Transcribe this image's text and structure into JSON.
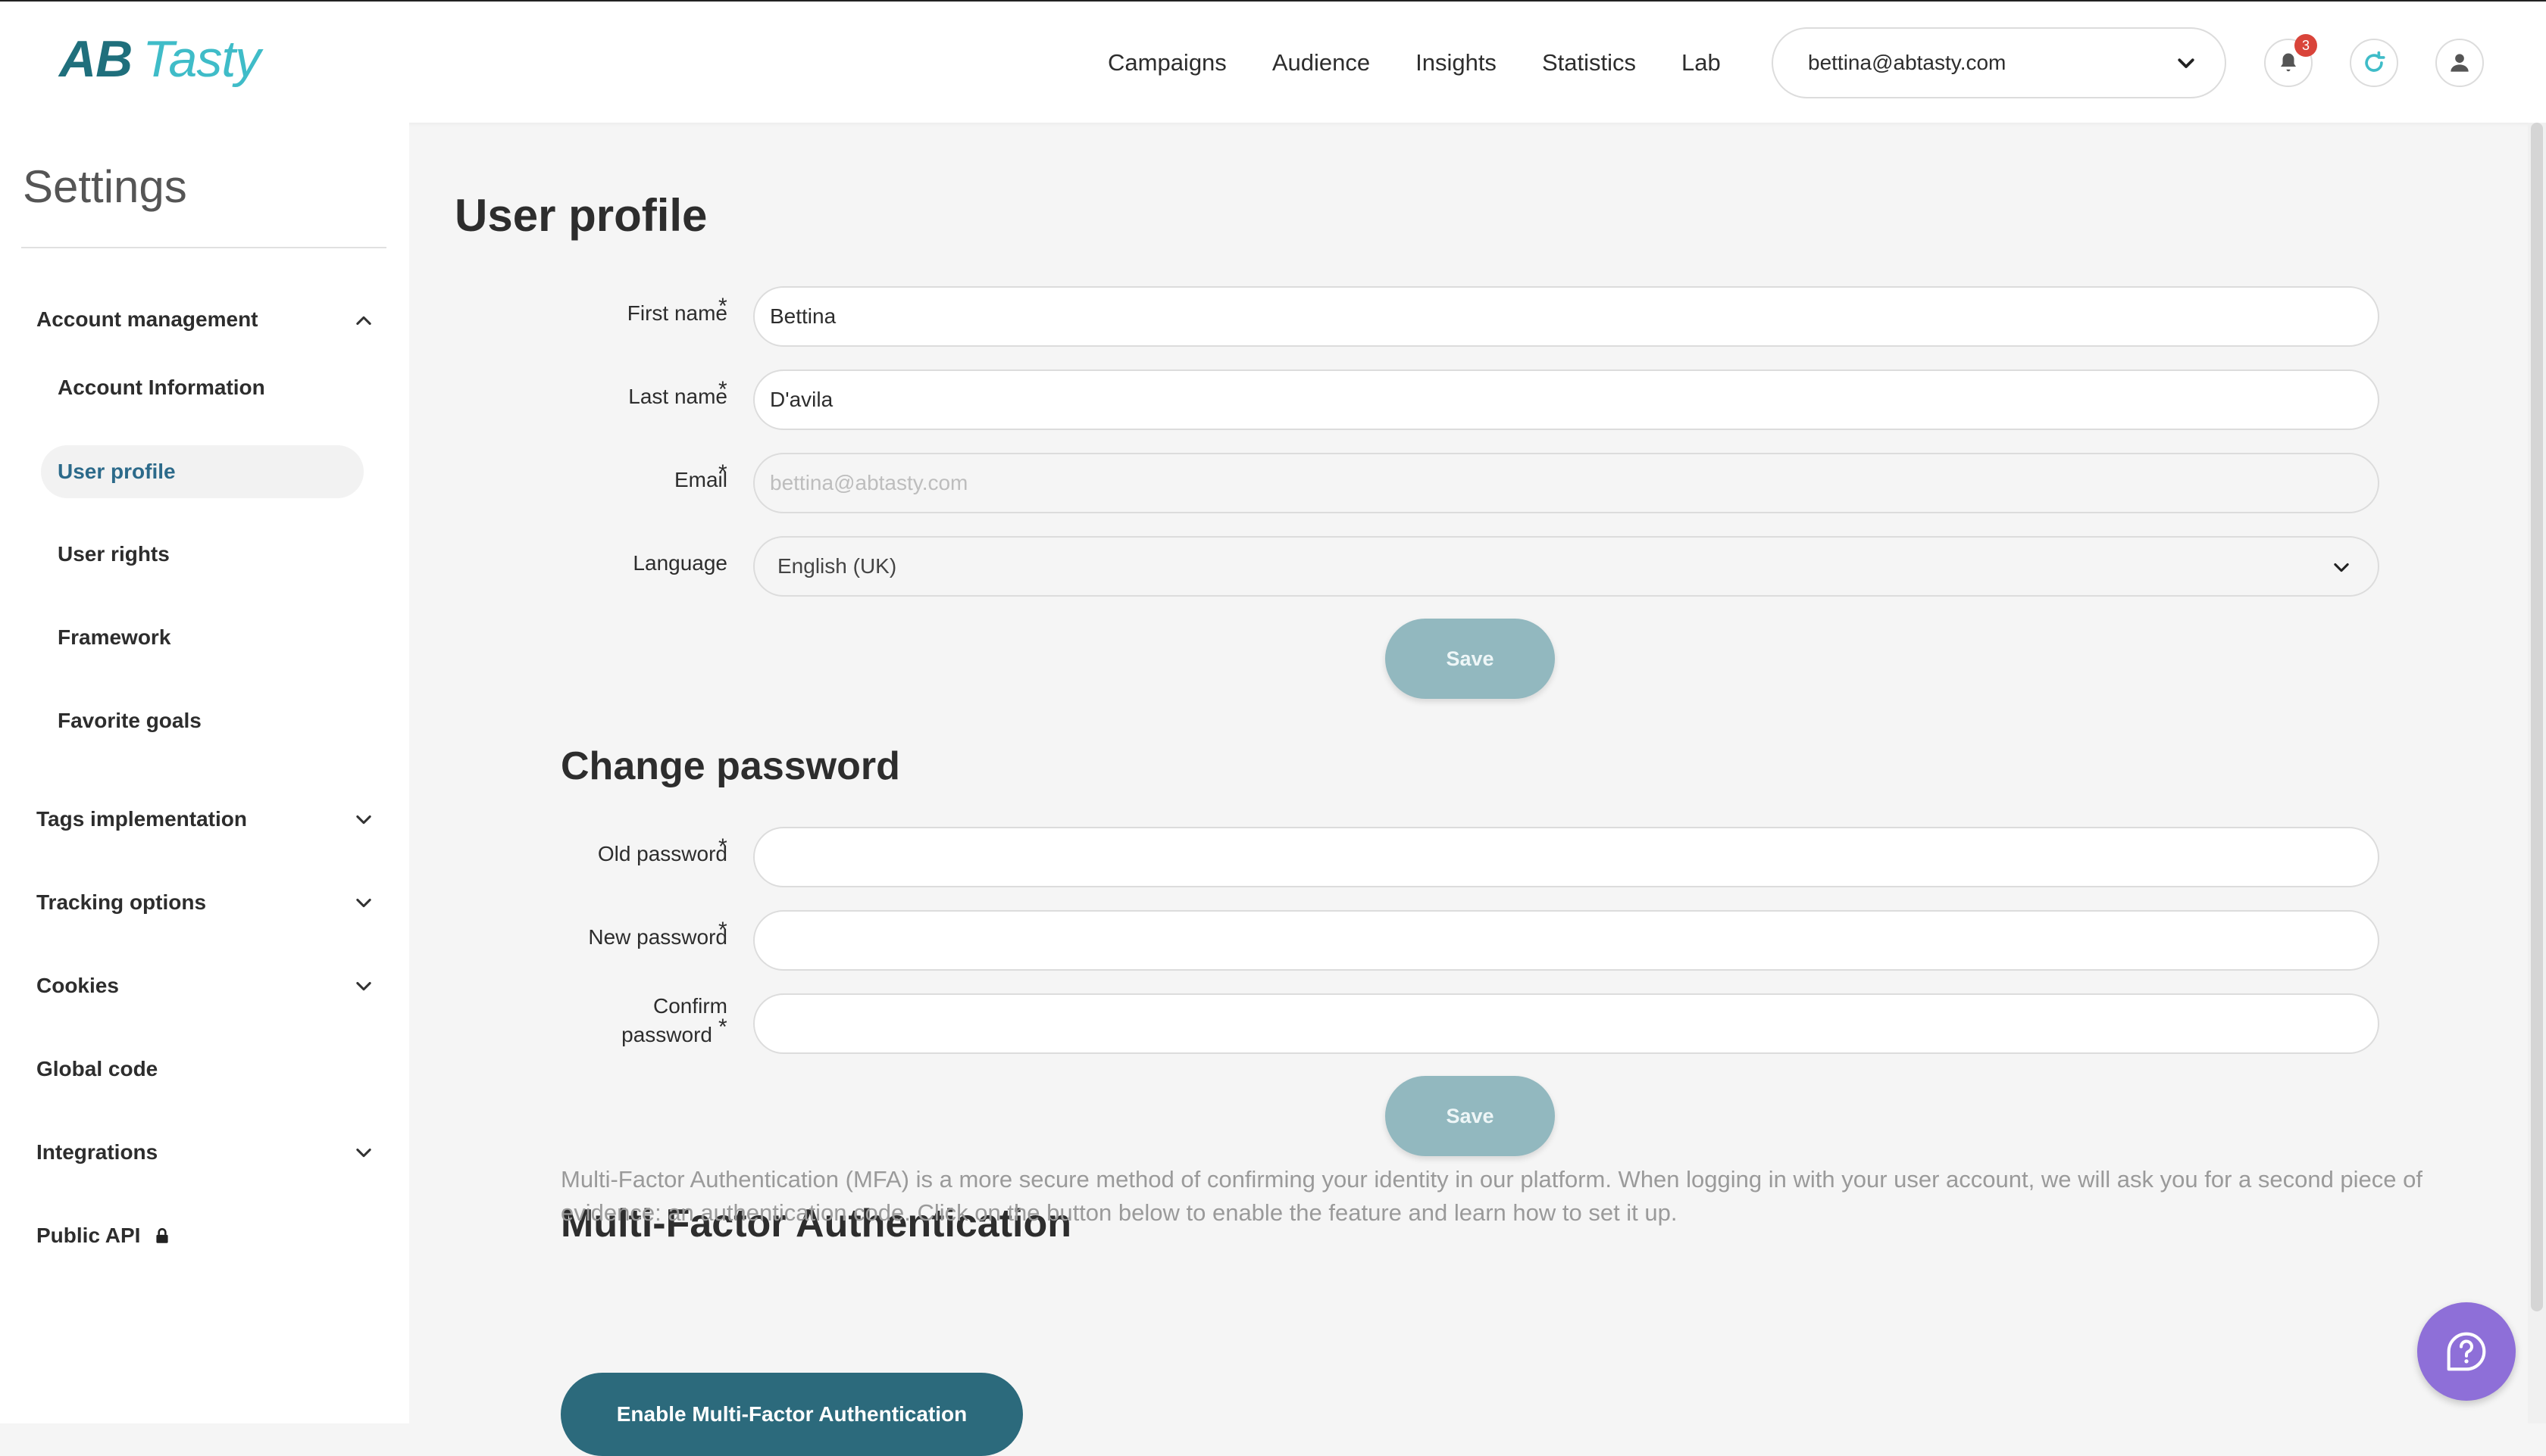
{
  "brand": {
    "logo_ab": "AB",
    "logo_tasty": "Tasty"
  },
  "nav": {
    "items": [
      "Campaigns",
      "Audience",
      "Insights",
      "Statistics",
      "Lab"
    ]
  },
  "account": {
    "email": "bettina@abtasty.com"
  },
  "notifications": {
    "count": "3"
  },
  "sidebar": {
    "title": "Settings",
    "groups": [
      {
        "label": "Account management",
        "expanded": true
      },
      {
        "label": "Tags implementation"
      },
      {
        "label": "Tracking options"
      },
      {
        "label": "Cookies"
      },
      {
        "label": "Global code"
      },
      {
        "label": "Integrations"
      },
      {
        "label": "Public API"
      }
    ],
    "sub_items": [
      "Account Information",
      "User profile",
      "User rights",
      "Framework",
      "Favorite goals"
    ],
    "active": "User profile"
  },
  "profile": {
    "title": "User profile",
    "first_name_label": "First name",
    "first_name_value": "Bettina",
    "last_name_label": "Last name",
    "last_name_value": "D'avila",
    "email_label": "Email",
    "email_placeholder": "bettina@abtasty.com",
    "language_label": "Language",
    "language_value": "English (UK)",
    "save_label": "Save",
    "required_mark": "*"
  },
  "password": {
    "title": "Change password",
    "old_label": "Old password",
    "new_label": "New password",
    "confirm_label_line1": "Confirm",
    "confirm_label_line2": "password",
    "save_label": "Save"
  },
  "mfa": {
    "title": "Multi-Factor Authentication",
    "description": "Multi-Factor Authentication (MFA) is a more secure method of confirming your identity in our platform. When logging in with your user account, we will ask you for a second piece of evidence: an authentication code. Click on the button below to enable the feature and learn how to set it up.",
    "button_label": "Enable Multi-Factor Authentication"
  },
  "colors": {
    "accent": "#2c6a7c",
    "brand_light": "#3fbcc8",
    "save_disabled": "#92b8bf",
    "help": "#8e6fd8",
    "badge": "#d9443a"
  }
}
